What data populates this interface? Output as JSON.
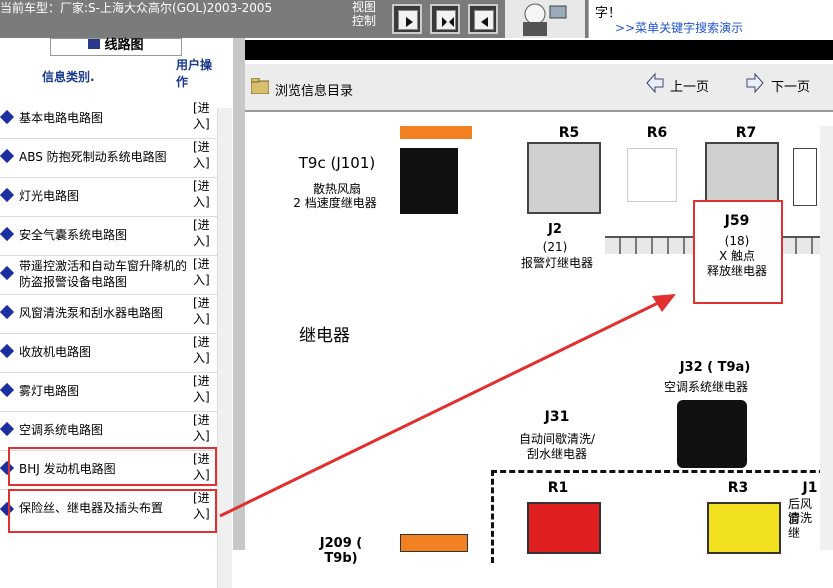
{
  "header": {
    "car_label": "当前车型：厂家:S-上海大众高尔(GOL)2003-2005",
    "view_control": "视图控制",
    "ad_line1": "字！",
    "ad_link": ">>菜单关键字搜索演示"
  },
  "sidebar": {
    "title": "线路图",
    "col_info": "信息类别.",
    "col_action": "用户操作",
    "items": [
      {
        "label": "基本电路电路图",
        "action": "[进入]"
      },
      {
        "label": "ABS 防抱死制动系统电路图",
        "action": "[进入]"
      },
      {
        "label": "灯光电路图",
        "action": "[进入]"
      },
      {
        "label": "安全气囊系统电路图",
        "action": "[进入]"
      },
      {
        "label": "带遥控激活和自动车窗升降机的防盗报警设备电路图",
        "action": "[进入]"
      },
      {
        "label": "风窗清洗泵和刮水器电路图",
        "action": "[进入]"
      },
      {
        "label": "收放机电路图",
        "action": "[进入]"
      },
      {
        "label": "雾灯电路图",
        "action": "[进入]"
      },
      {
        "label": "空调系统电路图",
        "action": "[进入]"
      },
      {
        "label": "BHJ 发动机电路图",
        "action": "[进入]"
      },
      {
        "label": "保险丝、继电器及插头布置",
        "action": "[进入]"
      }
    ]
  },
  "main": {
    "browse_label": "浏览信息目录",
    "prev_label": "上一页",
    "next_label": "下一页",
    "diagram": {
      "t9c": "T9c (J101)",
      "t9c_desc_a": "散热风扇",
      "t9c_desc_b": "2 档速度继电器",
      "r5": "R5",
      "r6": "R6",
      "r7": "R7",
      "j2": "J2",
      "j2_num": "(21)",
      "j2_desc": "报警灯继电器",
      "j59": "J59",
      "j59_num": "(18)",
      "j59_desc_a": "X 触点",
      "j59_desc_b": "释放继电器",
      "relay_title": "继电器",
      "j32": "J32 ( T9a)",
      "j32_desc": "空调系统继电器",
      "j31": "J31",
      "j31_desc_a": "自动间歇清洗/",
      "j31_desc_b": "刮水继电器",
      "r1": "R1",
      "r3": "R3",
      "rear_a": "后风窗",
      "rear_b": "清洗继",
      "j209": "J209 ( T9b)",
      "j1": "J1"
    }
  },
  "colors": {
    "accent_red": "#e03030",
    "relay_red": "#e02020",
    "relay_yellow": "#f0e020",
    "diamond_blue": "#1c2fa0"
  }
}
